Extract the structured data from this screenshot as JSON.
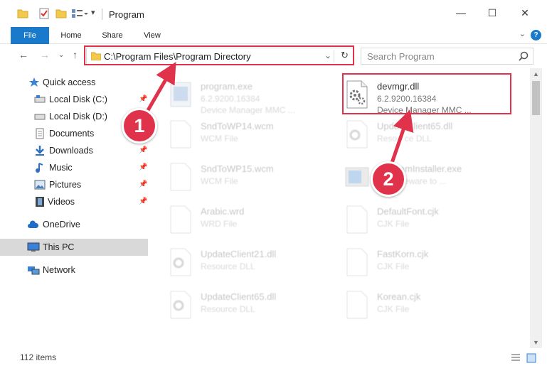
{
  "window": {
    "title": "Program",
    "minimize": "—",
    "maximize": "☐",
    "close": "✕"
  },
  "ribbon": {
    "tabs": [
      "File",
      "Home",
      "Share",
      "View"
    ],
    "help": "?"
  },
  "address": {
    "path": "C:\\Program Files\\Program Directory",
    "search_placeholder": "Search Program"
  },
  "sidebar": {
    "items": [
      {
        "label": "Quick access"
      },
      {
        "label": "Local Disk (C:)"
      },
      {
        "label": "Local Disk (D:)"
      },
      {
        "label": "Documents"
      },
      {
        "label": "Downloads"
      },
      {
        "label": "Music"
      },
      {
        "label": "Pictures"
      },
      {
        "label": "Videos"
      },
      {
        "label": "OneDrive"
      },
      {
        "label": "This PC"
      },
      {
        "label": "Network"
      }
    ]
  },
  "files": [
    {
      "name": "program.exe",
      "line2": "6.2.9200.16384",
      "line3": "Device Manager MMC ..."
    },
    {
      "name": "devmgr.dll",
      "line2": "6.2.9200.16384",
      "line3": "Device Manager MMC ..."
    },
    {
      "name": "SndToWP14.wcm",
      "line2": "WCM File",
      "line3": ""
    },
    {
      "name": "UpdateClient65.dll",
      "line2": "Resource DLL",
      "line3": ""
    },
    {
      "name": "SndToWP15.wcm",
      "line2": "WCM File",
      "line3": ""
    },
    {
      "name": "ProgramInstaller.exe",
      "line2": "1.1 Freeware to ...",
      "line3": ""
    },
    {
      "name": "Arabic.wrd",
      "line2": "WRD File",
      "line3": ""
    },
    {
      "name": "DefaultFont.cjk",
      "line2": "CJK File",
      "line3": ""
    },
    {
      "name": "UpdateClient21.dll",
      "line2": "Resource DLL",
      "line3": ""
    },
    {
      "name": "FastKorn.cjk",
      "line2": "CJK File",
      "line3": ""
    },
    {
      "name": "UpdateClient65.dll",
      "line2": "Resource DLL",
      "line3": ""
    },
    {
      "name": "Korean.cjk",
      "line2": "CJK File",
      "line3": ""
    }
  ],
  "status": {
    "item_count": "112 items"
  },
  "callouts": [
    "1",
    "2"
  ],
  "colors": {
    "accent": "#1979ca",
    "highlight": "#e0324b",
    "selected": "#d9d9d9"
  }
}
